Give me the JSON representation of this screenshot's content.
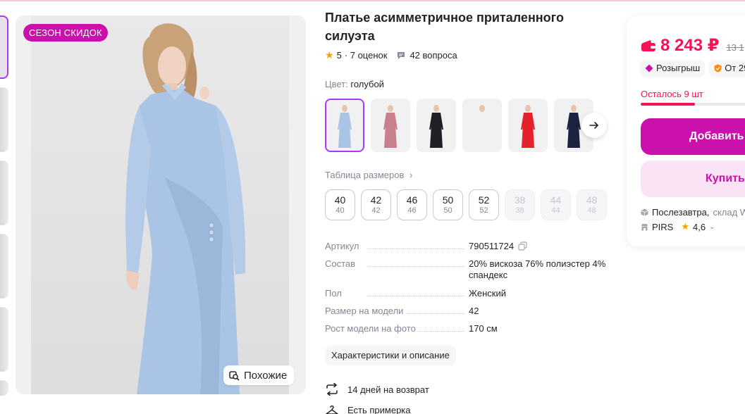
{
  "gallery": {
    "badge": "СЕЗОН СКИДОК",
    "similar_label": "Похожие"
  },
  "product": {
    "title": "Платье асимметричное приталенного силуэта",
    "rating": "5",
    "reviews": "· 7 оценок",
    "questions": "42 вопроса",
    "color_label": "Цвет:",
    "color_value": "голубой",
    "swatch_colors": [
      "#a9c4e4",
      "#c7808c",
      "#1f1f24",
      "#f2f2f2",
      "#e3222b",
      "#1c2340"
    ],
    "size_table_label": "Таблица размеров",
    "sizes": [
      {
        "ru": "40",
        "eu": "40",
        "available": true
      },
      {
        "ru": "42",
        "eu": "42",
        "available": true
      },
      {
        "ru": "46",
        "eu": "46",
        "available": true
      },
      {
        "ru": "50",
        "eu": "50",
        "available": true
      },
      {
        "ru": "52",
        "eu": "52",
        "available": true
      },
      {
        "ru": "38",
        "eu": "38",
        "available": false
      },
      {
        "ru": "44",
        "eu": "44",
        "available": false
      },
      {
        "ru": "48",
        "eu": "48",
        "available": false
      }
    ],
    "specs": [
      {
        "key": "Артикул",
        "value": "790511724"
      },
      {
        "key": "Состав",
        "value": "20% вискоза 76% полиэстер 4% спандекс"
      },
      {
        "key": "Пол",
        "value": "Женский"
      },
      {
        "key": "Размер на модели",
        "value": "42"
      },
      {
        "key": "Рост модели на фото",
        "value": "170 см"
      }
    ],
    "description_button": "Характеристики и описание",
    "return_text": "14 дней на возврат",
    "try_on_text": "Есть примерка"
  },
  "panel": {
    "price": "8 243 ₽",
    "old_price": "13 1",
    "promo_raffle": "Розыгрыш",
    "promo_installment": "От 29",
    "stock_text": "Осталось 9 шт",
    "stock_fraction": 0.45,
    "add_to_cart": "Добавить",
    "buy_now": "Купить",
    "delivery_day": "Послезавтра,",
    "delivery_place": "склад W",
    "seller_name": "PIRS",
    "seller_rating": "4,6"
  },
  "colors": {
    "accent": "#cb11ab",
    "price": "#f91155",
    "selection": "#a73afd",
    "star": "#ff9d00"
  }
}
